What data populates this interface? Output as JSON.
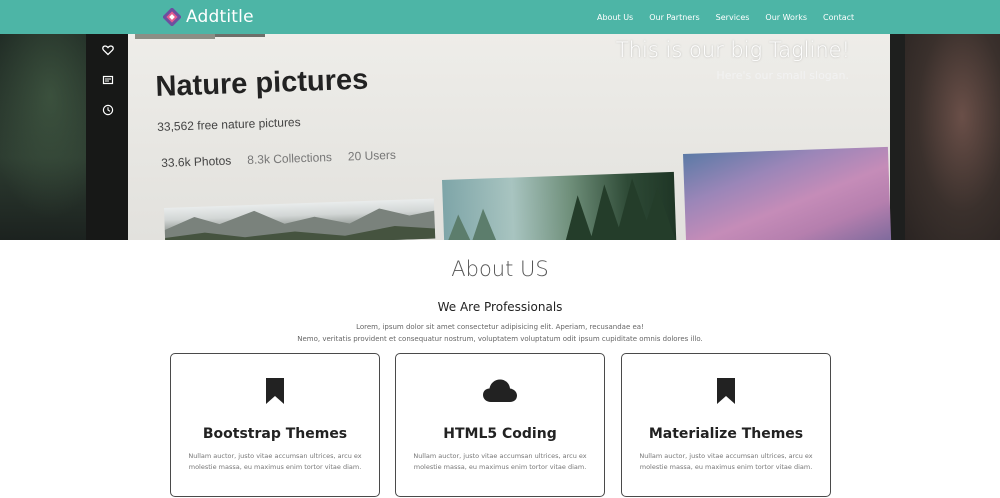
{
  "navbar": {
    "brand": "Addtitle",
    "links": [
      "About Us",
      "Our Partners",
      "Services",
      "Our Works",
      "Contact"
    ],
    "background_color": "#4db5a6"
  },
  "hero": {
    "tagline": "This is our big Tagline!",
    "slogan": "Here's our small slogan.",
    "screen": {
      "title": "Nature pictures",
      "subtitle": "33,562 free nature pictures",
      "stats": [
        "33.6k Photos",
        "8.3k Collections",
        "20 Users"
      ],
      "side_icons": [
        "heart-icon",
        "image-icon",
        "clock-icon"
      ]
    }
  },
  "about": {
    "title": "About US",
    "subtitle": "We Are Professionals",
    "paragraph_line1": "Lorem, ipsum dolor sit amet consectetur adipisicing elit. Aperiam, recusandae ea!",
    "paragraph_line2": "Nemo, veritatis provident et consequatur nostrum, voluptatem voluptatum odit ipsum cupiditate omnis dolores illo.",
    "cards": [
      {
        "icon": "bookmark-icon",
        "title": "Bootstrap Themes",
        "text": "Nullam auctor, justo vitae accumsan ultrices, arcu ex molestie massa, eu maximus enim tortor vitae diam."
      },
      {
        "icon": "cloud-icon",
        "title": "HTML5 Coding",
        "text": "Nullam auctor, justo vitae accumsan ultrices, arcu ex molestie massa, eu maximus enim tortor vitae diam."
      },
      {
        "icon": "bookmark-icon",
        "title": "Materialize Themes",
        "text": "Nullam auctor, justo vitae accumsan ultrices, arcu ex molestie massa, eu maximus enim tortor vitae diam."
      }
    ]
  }
}
